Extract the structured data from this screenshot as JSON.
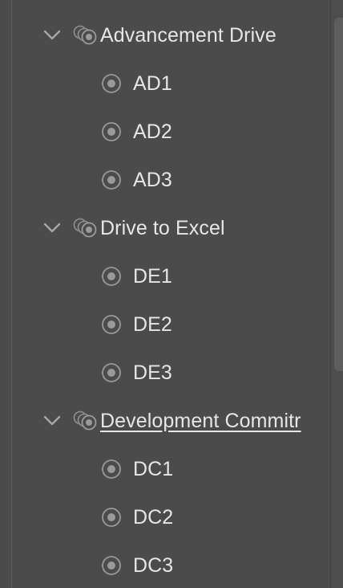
{
  "tree": {
    "groups": [
      {
        "label": "Advancement Drive",
        "expanded": true,
        "underlined": false,
        "children": [
          {
            "label": "AD1"
          },
          {
            "label": "AD2"
          },
          {
            "label": "AD3"
          }
        ]
      },
      {
        "label": "Drive to Excel",
        "expanded": true,
        "underlined": false,
        "children": [
          {
            "label": "DE1"
          },
          {
            "label": "DE2"
          },
          {
            "label": "DE3"
          }
        ]
      },
      {
        "label": "Development Commitr",
        "expanded": true,
        "underlined": true,
        "children": [
          {
            "label": "DC1"
          },
          {
            "label": "DC2"
          },
          {
            "label": "DC3"
          }
        ]
      }
    ]
  },
  "icons": {
    "chevron": "chevron-down-icon",
    "group": "layered-target-icon",
    "child": "target-icon"
  },
  "colors": {
    "background": "#4b4b4b",
    "text": "#e6e6e6",
    "icon": "#9a9a9a"
  }
}
